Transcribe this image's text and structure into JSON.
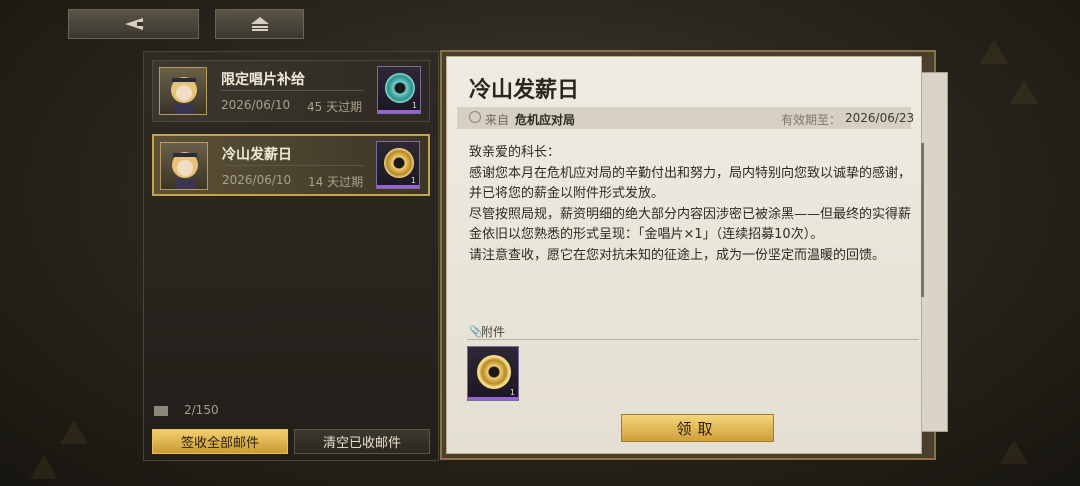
{
  "top_bar": {
    "back_icon": "back-arrow-icon",
    "home_icon": "home-icon"
  },
  "mail_list": {
    "items": [
      {
        "title": "限定唱片补给",
        "date": "2026/06/10",
        "expire": "45 天过期",
        "item_count": "1",
        "item_color": "teal",
        "selected": false
      },
      {
        "title": "冷山发薪日",
        "date": "2026/06/10",
        "expire": "14 天过期",
        "item_count": "1",
        "item_color": "gold",
        "selected": true
      }
    ],
    "count": "2/150",
    "claim_all_label": "签收全部邮件",
    "clear_read_label": "清空已收邮件"
  },
  "letter": {
    "title": "冷山发薪日",
    "from_label": "来自",
    "from_value": "危机应对局",
    "expiry_label": "有效期至：",
    "expiry_value": "2026/06/23",
    "body": [
      "致亲爱的科长：",
      "感谢您本月在危机应对局的辛勤付出和努力，局内特别向您致以诚挚的感谢，并已将您的薪金以附件形式发放。",
      "尽管按照局规，薪资明细的绝大部分内容因涉密已被涂黑——但最终的实得薪金依旧以您熟悉的形式呈现：「金唱片×1」（连续招募10次）。",
      "请注意查收，愿它在您对抗未知的征途上，成为一份坚定而温暖的回馈。"
    ],
    "attachment_label": "附件",
    "attachment_count": "1",
    "receive_label": "领取"
  },
  "colors": {
    "accent_gold": "#c9a24c",
    "rarity_purple": "#9a62d8"
  }
}
